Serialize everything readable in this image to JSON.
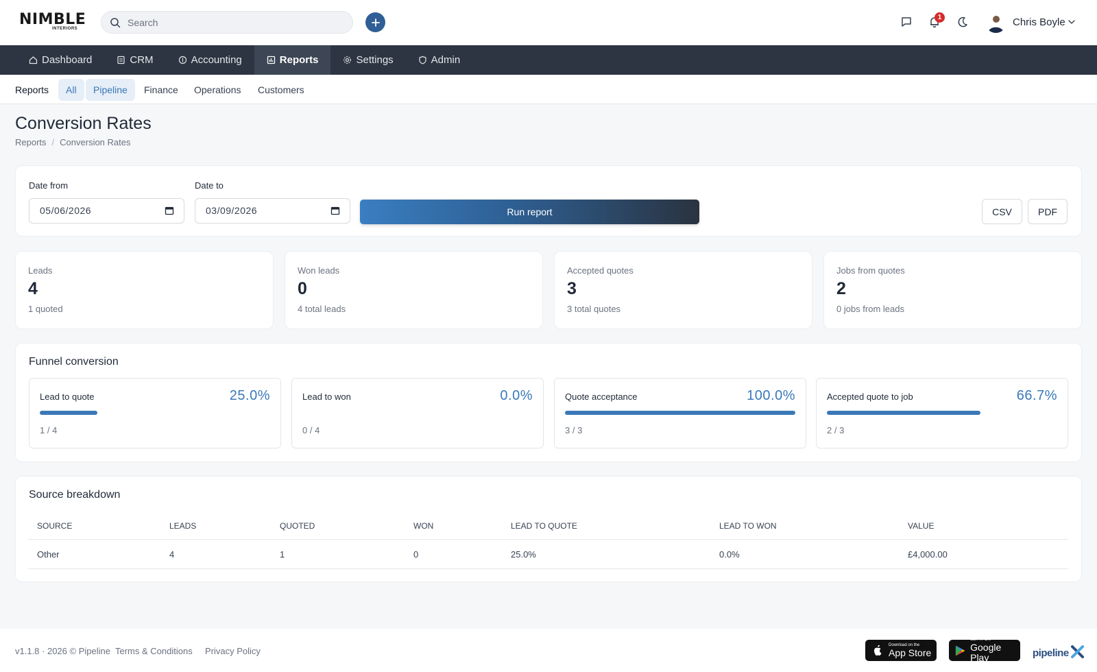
{
  "header": {
    "logo_text": "NIMBLE",
    "logo_sub": "INTERIORS",
    "search_placeholder": "Search",
    "notification_count": "1",
    "user_name": "Chris Boyle"
  },
  "nav": {
    "items": [
      {
        "label": "Dashboard",
        "icon": "home-icon"
      },
      {
        "label": "CRM",
        "icon": "crm-icon"
      },
      {
        "label": "Accounting",
        "icon": "coin-icon"
      },
      {
        "label": "Reports",
        "icon": "report-icon",
        "active": true
      },
      {
        "label": "Settings",
        "icon": "gear-icon"
      },
      {
        "label": "Admin",
        "icon": "shield-icon"
      }
    ]
  },
  "subnav": {
    "title": "Reports",
    "items": [
      "All",
      "Pipeline",
      "Finance",
      "Operations",
      "Customers"
    ]
  },
  "page": {
    "title": "Conversion Rates",
    "breadcrumb": [
      "Reports",
      "Conversion Rates"
    ]
  },
  "filters": {
    "date_from_label": "Date from",
    "date_from_value": "05/06/2026",
    "date_to_label": "Date to",
    "date_to_value": "03/09/2026",
    "run_label": "Run report",
    "csv_label": "CSV",
    "pdf_label": "PDF"
  },
  "kpis": [
    {
      "label": "Leads",
      "value": "4",
      "sub": "1 quoted"
    },
    {
      "label": "Won leads",
      "value": "0",
      "sub": "4 total leads"
    },
    {
      "label": "Accepted quotes",
      "value": "3",
      "sub": "3 total quotes"
    },
    {
      "label": "Jobs from quotes",
      "value": "2",
      "sub": "0 jobs from leads"
    }
  ],
  "funnel": {
    "title": "Funnel conversion",
    "items": [
      {
        "label": "Lead to quote",
        "percent": "25.0%",
        "ratio": "1 / 4",
        "fill": 0.25
      },
      {
        "label": "Lead to won",
        "percent": "0.0%",
        "ratio": "0 / 4",
        "fill": 0.0
      },
      {
        "label": "Quote acceptance",
        "percent": "100.0%",
        "ratio": "3 / 3",
        "fill": 1.0
      },
      {
        "label": "Accepted quote to job",
        "percent": "66.7%",
        "ratio": "2 / 3",
        "fill": 0.667
      }
    ]
  },
  "source": {
    "title": "Source breakdown",
    "headers": [
      "SOURCE",
      "LEADS",
      "QUOTED",
      "WON",
      "LEAD TO QUOTE",
      "LEAD TO WON",
      "VALUE"
    ],
    "rows": [
      [
        "Other",
        "4",
        "1",
        "0",
        "25.0%",
        "0.0%",
        "£4,000.00"
      ]
    ]
  },
  "footer": {
    "version": "v1.1.8 · 2026 © Pipeline",
    "terms": "Terms & Conditions",
    "privacy": "Privacy Policy",
    "app_store_small": "Download on the",
    "app_store_big": "App Store",
    "google_small": "GET IT ON",
    "google_big": "Google Play",
    "brand": "pipeline"
  },
  "colors": {
    "accent": "#3a78b8",
    "nav_bg": "#2c3541",
    "badge": "#d62b2b"
  }
}
